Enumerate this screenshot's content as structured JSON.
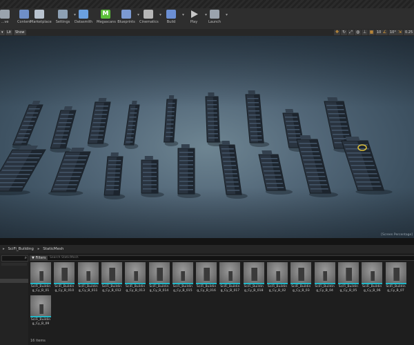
{
  "toolbar": {
    "items": [
      {
        "label": "...ve",
        "icon": "save-icon",
        "color": "#9aa3ad"
      },
      {
        "label": "Content",
        "icon": "content-browser-icon",
        "color": "#6f8fc8"
      },
      {
        "label": "Marketplace",
        "icon": "marketplace-icon",
        "color": "#b9c3cf"
      },
      {
        "label": "Settings",
        "icon": "gear-icon",
        "color": "#8da0b4"
      },
      {
        "label": "Datasmith",
        "icon": "datasmith-icon",
        "color": "#6aa0e0"
      },
      {
        "label": "Megascans",
        "icon": "megascans-icon",
        "color": "#5bbf3a"
      },
      {
        "label": "Blueprints",
        "icon": "blueprint-icon",
        "color": "#7c9ad2"
      },
      {
        "label": "Cinematics",
        "icon": "clapperboard-icon",
        "color": "#b7b7b7"
      },
      {
        "label": "Build",
        "icon": "build-icon",
        "color": "#6b8fd4"
      },
      {
        "label": "Play",
        "icon": "play-icon",
        "color": "#c8c8c8"
      },
      {
        "label": "Launch",
        "icon": "launch-icon",
        "color": "#9aa3ad"
      }
    ]
  },
  "viewport": {
    "lit_label": "Lit",
    "show_label": "Show",
    "snap_value": "10",
    "rotate_value": "10°",
    "scale_value": "0.25",
    "watermark": "[Screen Percentage]"
  },
  "content_browser": {
    "path": [
      "SciFi_Building",
      "StaticMesh"
    ],
    "filters_label": "Filters",
    "search_placeholder": "Search StaticMesh",
    "items_count": "16 items",
    "assets": [
      "SciFi_Building_Cy_B_01",
      "SciFi_Building_Cy_B_010",
      "SciFi_Building_Cy_B_011",
      "SciFi_Building_Cy_B_012",
      "SciFi_Building_Cy_B_013",
      "SciFi_Building_Cy_B_014",
      "SciFi_Building_Cy_B_015",
      "SciFi_Building_Cy_B_016",
      "SciFi_Building_Cy_B_017",
      "SciFi_Building_Cy_B_018",
      "SciFi_Building_Cy_B_02",
      "SciFi_Building_Cy_B_03",
      "SciFi_Building_Cy_B_04",
      "SciFi_Building_Cy_B_05",
      "SciFi_Building_Cy_B_06",
      "SciFi_Building_Cy_B_07",
      "SciFi_Building_Cy_B_09"
    ]
  }
}
